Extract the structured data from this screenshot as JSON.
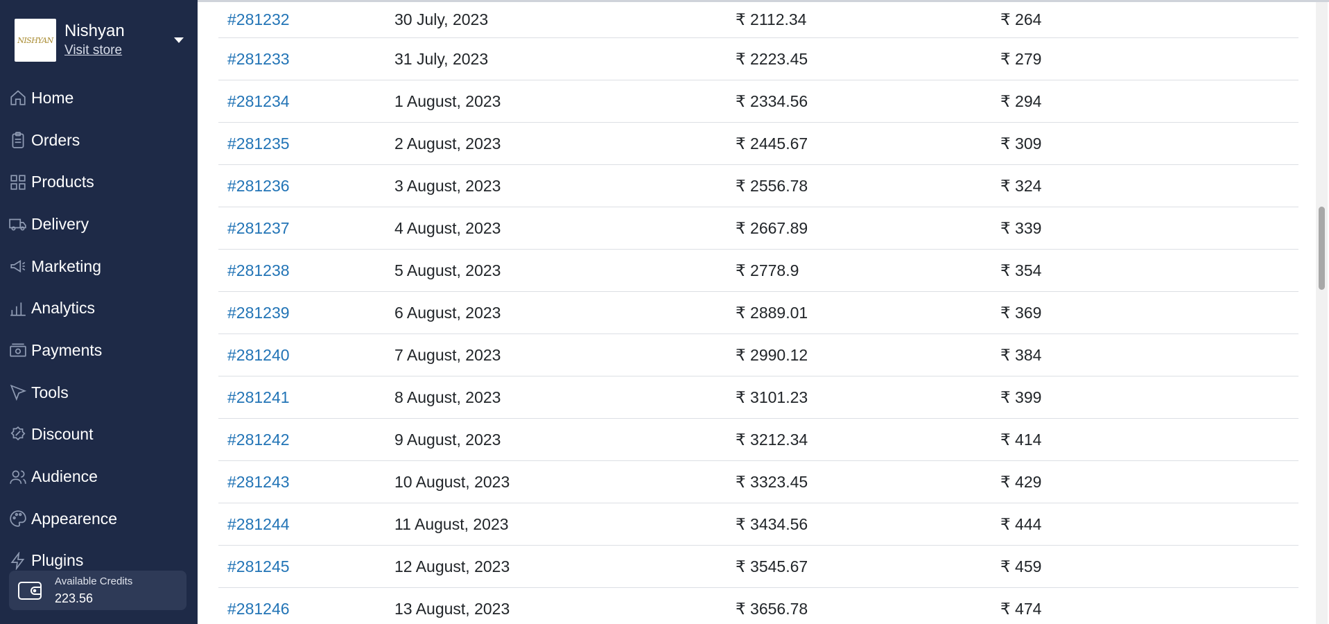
{
  "store": {
    "name": "Nishyan",
    "visit_label": "Visit store",
    "logo_text": "NISHYAN"
  },
  "nav": [
    {
      "label": "Home",
      "icon": "home-icon"
    },
    {
      "label": "Orders",
      "icon": "clipboard-icon"
    },
    {
      "label": "Products",
      "icon": "grid-icon"
    },
    {
      "label": "Delivery",
      "icon": "truck-icon"
    },
    {
      "label": "Marketing",
      "icon": "megaphone-icon"
    },
    {
      "label": "Analytics",
      "icon": "bar-chart-icon"
    },
    {
      "label": "Payments",
      "icon": "cash-icon"
    },
    {
      "label": "Tools",
      "icon": "cursor-icon"
    },
    {
      "label": "Discount",
      "icon": "discount-badge-icon"
    },
    {
      "label": "Audience",
      "icon": "users-icon"
    },
    {
      "label": "Appearence",
      "icon": "palette-icon"
    },
    {
      "label": "Plugins",
      "icon": "lightning-icon"
    }
  ],
  "credits": {
    "label": "Available Credits",
    "value": "223.56"
  },
  "orders": [
    {
      "id": "#281232",
      "date": "30 July, 2023",
      "total": "₹ 2112.34",
      "fee": "₹ 264"
    },
    {
      "id": "#281233",
      "date": "31 July, 2023",
      "total": "₹ 2223.45",
      "fee": "₹ 279"
    },
    {
      "id": "#281234",
      "date": "1 August, 2023",
      "total": "₹ 2334.56",
      "fee": "₹ 294"
    },
    {
      "id": "#281235",
      "date": "2 August, 2023",
      "total": "₹ 2445.67",
      "fee": "₹ 309"
    },
    {
      "id": "#281236",
      "date": "3 August, 2023",
      "total": "₹ 2556.78",
      "fee": "₹ 324"
    },
    {
      "id": "#281237",
      "date": "4 August, 2023",
      "total": "₹ 2667.89",
      "fee": "₹ 339"
    },
    {
      "id": "#281238",
      "date": "5 August, 2023",
      "total": "₹ 2778.9",
      "fee": "₹ 354"
    },
    {
      "id": "#281239",
      "date": "6 August, 2023",
      "total": "₹ 2889.01",
      "fee": "₹ 369"
    },
    {
      "id": "#281240",
      "date": "7 August, 2023",
      "total": "₹ 2990.12",
      "fee": "₹ 384"
    },
    {
      "id": "#281241",
      "date": "8 August, 2023",
      "total": "₹ 3101.23",
      "fee": "₹ 399"
    },
    {
      "id": "#281242",
      "date": "9 August, 2023",
      "total": "₹ 3212.34",
      "fee": "₹ 414"
    },
    {
      "id": "#281243",
      "date": "10 August, 2023",
      "total": "₹ 3323.45",
      "fee": "₹ 429"
    },
    {
      "id": "#281244",
      "date": "11 August, 2023",
      "total": "₹ 3434.56",
      "fee": "₹ 444"
    },
    {
      "id": "#281245",
      "date": "12 August, 2023",
      "total": "₹ 3545.67",
      "fee": "₹ 459"
    },
    {
      "id": "#281246",
      "date": "13 August, 2023",
      "total": "₹ 3656.78",
      "fee": "₹ 474"
    }
  ],
  "colors": {
    "sidebar": "#1e2a47",
    "link": "#2274b6",
    "credits_bg": "#2e3a57"
  }
}
